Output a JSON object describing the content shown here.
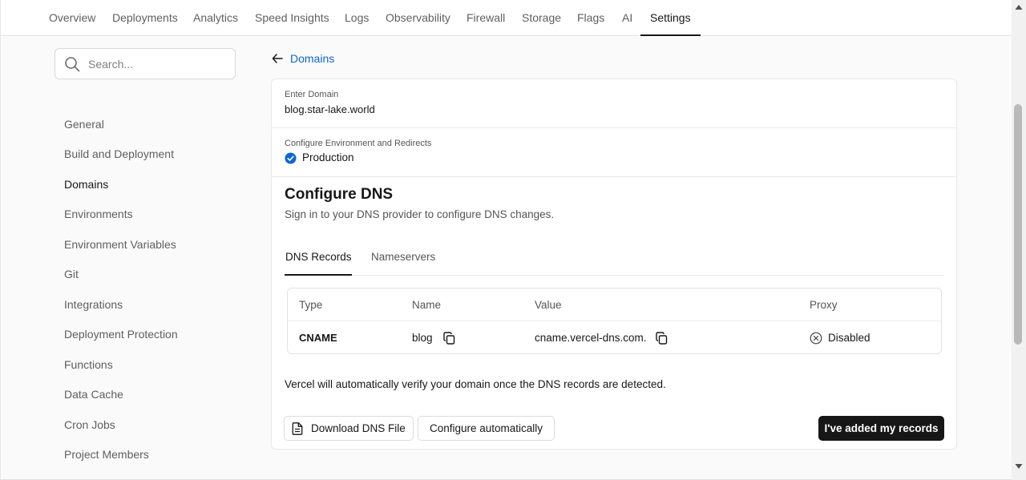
{
  "nav": {
    "tabs": [
      {
        "label": "Overview"
      },
      {
        "label": "Deployments"
      },
      {
        "label": "Analytics"
      },
      {
        "label": "Speed Insights"
      },
      {
        "label": "Logs"
      },
      {
        "label": "Observability"
      },
      {
        "label": "Firewall"
      },
      {
        "label": "Storage"
      },
      {
        "label": "Flags"
      },
      {
        "label": "AI"
      },
      {
        "label": "Settings",
        "active": true
      }
    ]
  },
  "sidebar": {
    "search_placeholder": "Search...",
    "items": [
      {
        "label": "General"
      },
      {
        "label": "Build and Deployment"
      },
      {
        "label": "Domains",
        "active": true
      },
      {
        "label": "Environments"
      },
      {
        "label": "Environment Variables"
      },
      {
        "label": "Git"
      },
      {
        "label": "Integrations"
      },
      {
        "label": "Deployment Protection"
      },
      {
        "label": "Functions"
      },
      {
        "label": "Data Cache"
      },
      {
        "label": "Cron Jobs"
      },
      {
        "label": "Project Members"
      }
    ]
  },
  "main": {
    "back_label": "Domains",
    "domain": {
      "label": "Enter Domain",
      "value": "blog.star-lake.world"
    },
    "environment": {
      "label": "Configure Environment and Redirects",
      "selected": "Production"
    },
    "dns": {
      "title": "Configure DNS",
      "subtitle": "Sign in to your DNS provider to configure DNS changes.",
      "tabs": [
        {
          "label": "DNS Records",
          "active": true
        },
        {
          "label": "Nameservers"
        }
      ],
      "table": {
        "headers": [
          "Type",
          "Name",
          "Value",
          "Proxy"
        ],
        "rows": [
          {
            "type": "CNAME",
            "name": "blog",
            "value": "cname.vercel-dns.com.",
            "proxy": "Disabled"
          }
        ]
      },
      "note": "Vercel will automatically verify your domain once the DNS records are detected.",
      "buttons": {
        "download": "Download DNS File",
        "configure": "Configure automatically",
        "added": "I've added my records"
      }
    }
  },
  "colors": {
    "accent_link": "#0b67d4",
    "check_blue": "#0b67d4",
    "primary_button": "#171717"
  }
}
